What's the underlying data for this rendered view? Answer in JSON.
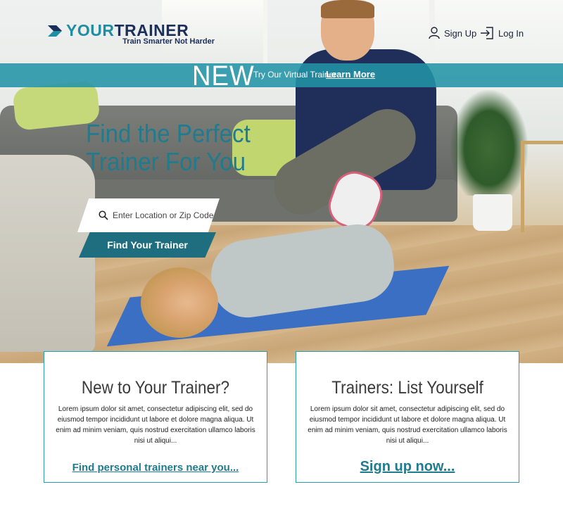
{
  "header": {
    "logo": {
      "word_first": "YOUR",
      "word_second": "TRAINER",
      "tagline": "Train Smarter Not Harder"
    },
    "nav": {
      "signup_label": "Sign Up",
      "login_label": "Log In"
    }
  },
  "promo": {
    "badge": "NEW",
    "text": "Try Our Virtual Trainer",
    "link_label": "Learn More"
  },
  "hero": {
    "headline_line1": "Find the Perfect",
    "headline_line2": "Trainer For You",
    "search": {
      "placeholder": "Enter Location or Zip Code",
      "value": ""
    },
    "find_button_label": "Find Your Trainer"
  },
  "cards": [
    {
      "title": "New to Your Trainer?",
      "body": "Lorem ipsum dolor sit amet, consectetur adipiscing elit, sed do eiusmod tempor incididunt ut labore et dolore magna aliqua. Ut enim ad minim veniam, quis nostrud exercitation ullamco laboris nisi ut aliqui...",
      "link_label": "Find personal trainers near you..."
    },
    {
      "title": "Trainers: List Yourself",
      "body": "Lorem ipsum dolor sit amet, consectetur adipiscing elit, sed do eiusmod tempor incididunt ut labore et dolore magna aliqua. Ut enim ad minim veniam, quis nostrud exercitation ullamco laboris nisi ut aliqui...",
      "link_label": "Sign up now..."
    }
  ],
  "icons": {
    "logo_mark": "chevron-right-icon",
    "signup": "user-icon",
    "login": "login-arrow-icon",
    "search": "search-icon"
  },
  "colors": {
    "brand_teal": "#1f8ea3",
    "brand_navy": "#1c2e5a",
    "promo_band": "#2394a6",
    "button": "#1f6e80",
    "card_border": "#27a0b5"
  }
}
